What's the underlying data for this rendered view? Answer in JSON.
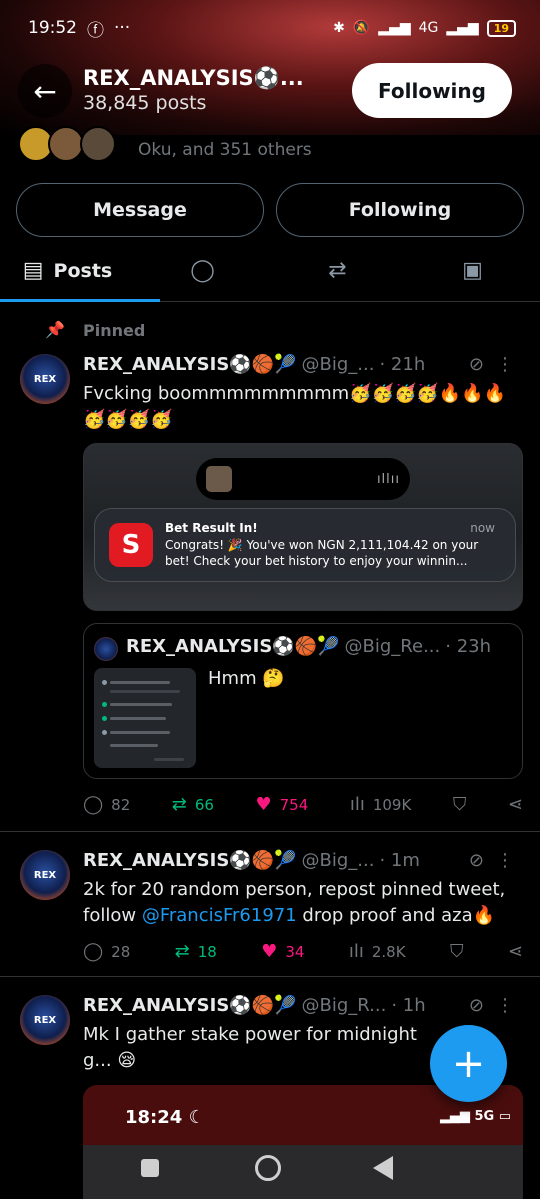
{
  "status": {
    "time": "19:52",
    "network": "4G",
    "battery": "19"
  },
  "header": {
    "title": "REX_ANALYSIS⚽...",
    "post_count": "38,845 posts",
    "follow_label": "Following"
  },
  "profile": {
    "followed_by_text": "Oku, and 351 others",
    "message_label": "Message",
    "following_label": "Following"
  },
  "tabs": [
    {
      "label": "Posts",
      "icon": "posts-icon"
    },
    {
      "icon": "replies-icon"
    },
    {
      "icon": "retweet-icon"
    },
    {
      "icon": "media-icon"
    }
  ],
  "pinned_label": "Pinned",
  "tweets": [
    {
      "name": "REX_ANALYSIS⚽🏀🎾",
      "handle": "@Big_...",
      "time": "· 21h",
      "text": "Fvcking boommmmmmmmm🥳🥳🥳🥳🔥🔥🔥🥳🥳🥳🥳",
      "notification": {
        "title": "Bet Result In!",
        "time": "now",
        "body": "Congrats! 🎉 You've won NGN 2,111,104.42 on your bet! Check your bet history to enjoy your winnin..."
      },
      "quote": {
        "name": "REX_ANALYSIS⚽🏀🎾",
        "handle": "@Big_Re...",
        "time": "· 23h",
        "text": "Hmm 🤔"
      },
      "replies": "82",
      "reposts": "66",
      "likes": "754",
      "views": "109K"
    },
    {
      "name": "REX_ANALYSIS⚽🏀🎾",
      "handle": "@Big_...",
      "time": "· 1m",
      "text_prefix": "2k for 20 random person, repost pinned tweet, follow ",
      "mention": "@FrancisFr61971",
      "text_suffix": " drop proof and aza🔥",
      "replies": "28",
      "reposts": "18",
      "likes": "34",
      "views": "2.8K"
    },
    {
      "name": "REX_ANALYSIS⚽🏀🎾",
      "handle": "@Big_R...",
      "time": "· 1h",
      "text": "Mk I gather stake power for midnight g... 😪",
      "media": {
        "time": "18:24",
        "network": "5G"
      }
    }
  ],
  "colors": {
    "accent": "#1d9bf0",
    "repost": "#00ba7c",
    "like": "#f91880"
  }
}
